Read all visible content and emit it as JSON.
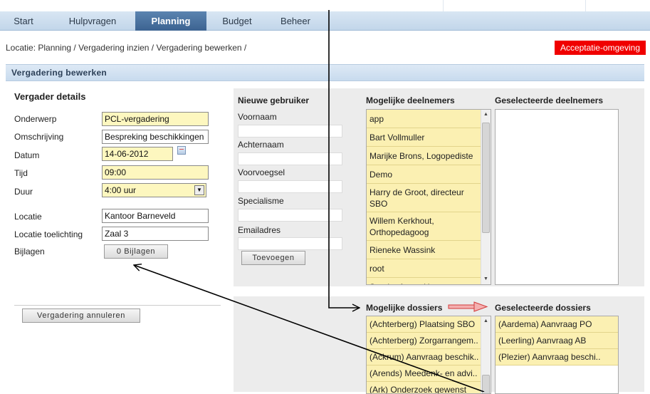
{
  "nav": {
    "tabs": [
      "Start",
      "Hulpvragen",
      "Planning",
      "Budget",
      "Beheer"
    ],
    "active": "Planning"
  },
  "breadcrumb": "Locatie: Planning / Vergadering inzien / Vergadering bewerken /",
  "environment_badge": "Acceptatie-omgeving",
  "section_title": "Vergadering bewerken",
  "details": {
    "title": "Vergader details",
    "onderwerp_label": "Onderwerp",
    "onderwerp_value": "PCL-vergadering",
    "omschrijving_label": "Omschrijving",
    "omschrijving_value": "Bespreking beschikkingen",
    "datum_label": "Datum",
    "datum_value": "14-06-2012",
    "tijd_label": "Tijd",
    "tijd_value": "09:00",
    "duur_label": "Duur",
    "duur_value": "4:00 uur",
    "locatie_label": "Locatie",
    "locatie_value": "Kantoor Barneveld",
    "locatie_toelichting_label": "Locatie toelichting",
    "locatie_toelichting_value": "Zaal 3",
    "bijlagen_label": "Bijlagen",
    "bijlagen_button": "0 Bijlagen",
    "cancel_button": "Vergadering annuleren"
  },
  "new_user": {
    "title": "Nieuwe gebruiker",
    "voornaam_label": "Voornaam",
    "achternaam_label": "Achternaam",
    "voorvoegsel_label": "Voorvoegsel",
    "specialisme_label": "Specialisme",
    "email_label": "Emailadres",
    "add_button": "Toevoegen"
  },
  "participants": {
    "possible_title": "Mogelijke deelnemers",
    "selected_title": "Geselecteerde deelnemers",
    "possible": [
      [
        "app"
      ],
      [
        "Bart Vollmuller"
      ],
      [
        "Marijke Brons, Logopediste"
      ],
      [
        "Demo"
      ],
      [
        "Harry de Groot, directeur",
        "SBO"
      ],
      [
        "Willem Kerkhout,",
        "Orthopedagoog"
      ],
      [
        "Rieneke Wassink"
      ],
      [
        "root"
      ],
      [
        "Sander Aarts, Hotemetoot"
      ]
    ],
    "selected": []
  },
  "dossiers": {
    "possible_title": "Mogelijke dossiers",
    "selected_title": "Geselecteerde dossiers",
    "possible": [
      "(Achterberg) Plaatsing SBO",
      "(Achterberg) Zorgarrangem..",
      "(Ackrum) Aanvraag beschik..",
      "(Arends) Meedenk- en advi..",
      "(Ark) Onderzoek gewenst"
    ],
    "selected": [
      "(Aardema) Aanvraag PO",
      "(Leerling) Aanvraag AB",
      "(Plezier) Aanvraag beschi.."
    ]
  },
  "colors": {
    "nav_active": "#3c6391",
    "badge": "#f00000",
    "list_item": "#fbf0b2",
    "panel": "#ececec",
    "annotation_arrow": "#e05050"
  }
}
